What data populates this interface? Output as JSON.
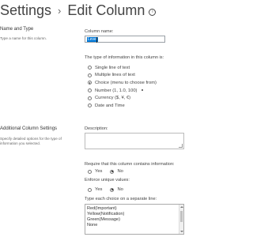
{
  "header": {
    "breadcrumb_root": "Settings",
    "separator": "›",
    "page_title": "Edit Column",
    "info_glyph": "i"
  },
  "name_type": {
    "heading": "Name and Type",
    "description": "Type a name for this column.",
    "column_name_label": "Column name:",
    "column_name_value": "Level",
    "type_label": "The type of information in this column is:",
    "type_options": [
      {
        "label": "Single line of text",
        "selected": false
      },
      {
        "label": "Multiple lines of text",
        "selected": false
      },
      {
        "label": "Choice (menu to choose from)",
        "selected": true
      },
      {
        "label": "Number (1, 1.0, 100)",
        "selected": false
      },
      {
        "label": "Currency ($, ¥, €)",
        "selected": false
      },
      {
        "label": "Date and Time",
        "selected": false
      }
    ]
  },
  "additional": {
    "heading": "Additional Column Settings",
    "description_line1": "Specify detailed options for the type of",
    "description_line2": "information you selected.",
    "description_label": "Description:",
    "description_value": "",
    "require_label": "Require that this column contains information:",
    "require_options": [
      {
        "label": "Yes",
        "selected": false
      },
      {
        "label": "No",
        "selected": true
      }
    ],
    "unique_label": "Enforce unique values:",
    "unique_options": [
      {
        "label": "Yes",
        "selected": false
      },
      {
        "label": "No",
        "selected": true
      }
    ],
    "choices_label": "Type each choice on a separate line:",
    "choices": [
      "Red(Important)",
      "Yellow(Notification)",
      "Green(Message)",
      "None"
    ]
  }
}
